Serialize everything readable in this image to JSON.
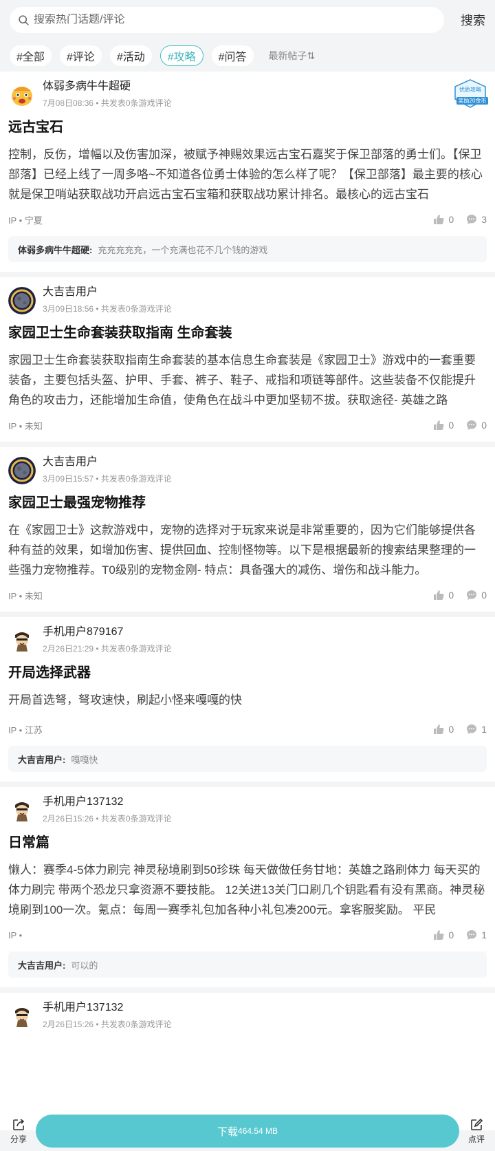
{
  "search": {
    "placeholder": "搜索热门话题/评论",
    "button": "搜索"
  },
  "tags": [
    {
      "label": "#全部",
      "active": false
    },
    {
      "label": "#评论",
      "active": false
    },
    {
      "label": "#活动",
      "active": false
    },
    {
      "label": "#攻略",
      "active": true
    },
    {
      "label": "#问答",
      "active": false
    }
  ],
  "sort_label": "最新帖子⇅",
  "posts": [
    {
      "author": "体弱多病牛牛超硬",
      "avatar": "angry-face-avatar",
      "meta": "7月08日08:36 • 共发表0条游戏评论",
      "badge": {
        "line1": "优质攻略",
        "line2": "奖励20金币"
      },
      "title": "远古宝石",
      "body": "控制，反伤，增幅以及伤害加深，被赋予神赐效果远古宝石嘉奖于保卫部落的勇士们。【保卫部落】已经上线了一周多咯~不知道各位勇士体验的怎么样了呢？【保卫部落】最主要的核心就是保卫哨站获取战功开启远古宝石宝箱和获取战功累计排名。最核心的远古宝石",
      "ip": "IP • 宁夏",
      "likes": "0",
      "comments": "3",
      "reply": {
        "user": "体弱多病牛牛超硬:",
        "text": "充充充充充，一个充满也花不几个钱的游戏"
      }
    },
    {
      "author": "大吉吉用户",
      "avatar": "moon-avatar",
      "meta": "3月09日18:56 • 共发表0条游戏评论",
      "title": "家园卫士生命套装获取指南 生命套装",
      "body": "家园卫士生命套装获取指南生命套装的基本信息生命套装是《家园卫士》游戏中的一套重要装备，主要包括头盔、护甲、手套、裤子、鞋子、戒指和项链等部件。这些装备不仅能提升角色的攻击力，还能增加生命值，使角色在战斗中更加坚韧不拔。获取途径- 英雄之路",
      "ip": "IP • 未知",
      "likes": "0",
      "comments": "0"
    },
    {
      "author": "大吉吉用户",
      "avatar": "moon-avatar",
      "meta": "3月09日15:57 • 共发表0条游戏评论",
      "title": "家园卫士最强宠物推荐",
      "body": "在《家园卫士》这款游戏中，宠物的选择对于玩家来说是非常重要的，因为它们能够提供各种有益的效果，如增加伤害、提供回血、控制怪物等。以下是根据最新的搜索结果整理的一些强力宠物推荐。T0级别的宠物金刚- 特点：具备强大的减伤、增伤和战斗能力。",
      "ip": "IP • 未知",
      "likes": "0",
      "comments": "0"
    },
    {
      "author": "手机用户879167",
      "avatar": "cartoon-character-avatar",
      "meta": "2月26日21:29 • 共发表0条游戏评论",
      "title": "开局选择武器",
      "body": "开局首选弩，弩攻速快，刷起小怪来嘎嘎的快",
      "ip": "IP • 江苏",
      "likes": "0",
      "comments": "1",
      "reply": {
        "user": "大吉吉用户:",
        "text": "嘎嘎快"
      }
    },
    {
      "author": "手机用户137132",
      "avatar": "cartoon-character-avatar",
      "meta": "2月26日15:26 • 共发表0条游戏评论",
      "title": "日常篇",
      "body": "懒人：赛季4-5体力刷完 神灵秘境刷到50珍珠 每天做做任务甘地：英雄之路刷体力 每天买的体力刷完 带两个恐龙只拿资源不要技能。 12关进13关门口刷几个钥匙看有没有黑商。神灵秘境刷到100一次。氪点：每周一赛季礼包加各种小礼包凑200元。拿客服奖励。 平民",
      "ip": "IP •",
      "likes": "0",
      "comments": "1",
      "reply": {
        "user": "大吉吉用户:",
        "text": "可以的"
      }
    },
    {
      "author": "手机用户137132",
      "avatar": "cartoon-character-avatar",
      "meta": "2月26日15:26 • 共发表0条游戏评论"
    }
  ],
  "bottom": {
    "share": "分享",
    "download": "下载",
    "size": "464.54 MB",
    "review": "点评"
  },
  "colors": {
    "accent": "#58c8d0",
    "tag_active": "#4bbfc6"
  }
}
